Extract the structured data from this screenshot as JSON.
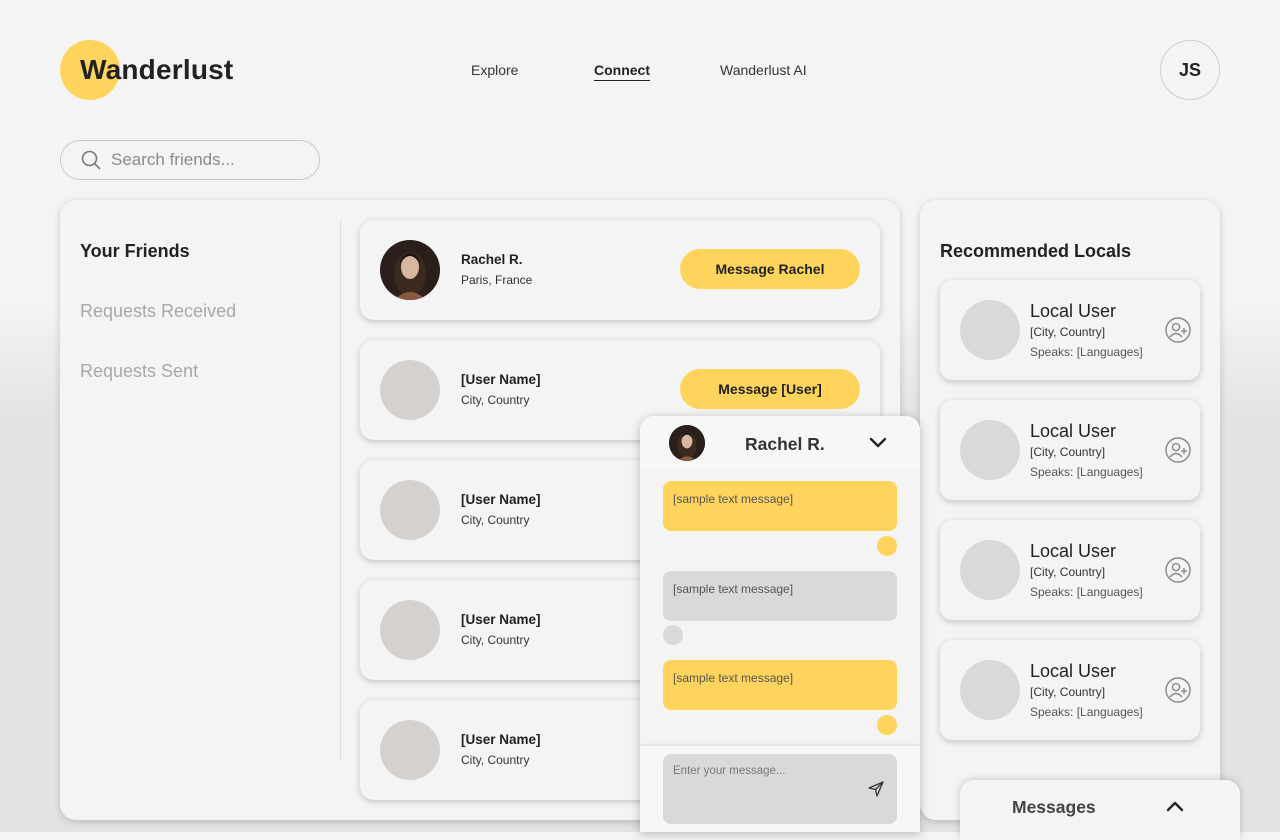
{
  "brand": {
    "name": "Wanderlust",
    "accent": "#ffd45c"
  },
  "nav": {
    "items": [
      {
        "label": "Explore",
        "active": false
      },
      {
        "label": "Connect",
        "active": true
      },
      {
        "label": "Wanderlust AI",
        "active": false
      }
    ]
  },
  "user": {
    "initials": "JS"
  },
  "search": {
    "placeholder": "Search friends...",
    "value": "",
    "icon": "search-icon"
  },
  "sidebar": {
    "items": [
      {
        "label": "Your Friends",
        "active": true
      },
      {
        "label": "Requests Received",
        "active": false
      },
      {
        "label": "Requests Sent",
        "active": false
      }
    ]
  },
  "friends": [
    {
      "name": "Rachel R.",
      "location": "Paris, France",
      "button": "Message Rachel",
      "has_photo": true
    },
    {
      "name": "[User Name]",
      "location": "City, Country",
      "button": "Message [User]",
      "has_photo": false
    },
    {
      "name": "[User Name]",
      "location": "City, Country",
      "button": "",
      "has_photo": false
    },
    {
      "name": "[User Name]",
      "location": "City, Country",
      "button": "",
      "has_photo": false
    },
    {
      "name": "[User Name]",
      "location": "City, Country",
      "button": "",
      "has_photo": false
    }
  ],
  "recommended": {
    "title": "Recommended Locals",
    "locals": [
      {
        "name": "Local User",
        "city": "[City, Country]",
        "languages": "Speaks: [Languages]",
        "icon": "add-user-icon"
      },
      {
        "name": "Local User",
        "city": "[City, Country]",
        "languages": "Speaks: [Languages]",
        "icon": "add-user-icon"
      },
      {
        "name": "Local User",
        "city": "[City, Country]",
        "languages": "Speaks: [Languages]",
        "icon": "add-user-icon"
      },
      {
        "name": "Local User",
        "city": "[City, Country]",
        "languages": "Speaks: [Languages]",
        "icon": "add-user-icon"
      }
    ]
  },
  "chat": {
    "contact": "Rachel R.",
    "collapse_icon": "chevron-down-icon",
    "messages": [
      {
        "text": "[sample text message]",
        "from": "me"
      },
      {
        "text": "[sample text message]",
        "from": "them"
      },
      {
        "text": "[sample text message]",
        "from": "me"
      }
    ],
    "input_placeholder": "Enter your message...",
    "send_icon": "send-icon"
  },
  "messages_bar": {
    "label": "Messages",
    "icon": "chevron-up-icon"
  }
}
